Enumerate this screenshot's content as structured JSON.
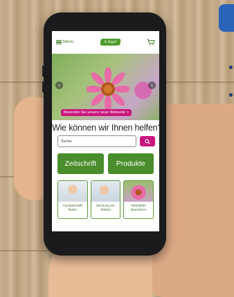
{
  "header": {
    "menu_label": "Menu",
    "logo_text": "A.Vogel",
    "cart_icon": "cart-icon"
  },
  "hero": {
    "review_button": "Bewerten Sie unsere neue Webseite >"
  },
  "heading": "Wie können wir Ihnen helfen?",
  "search": {
    "placeholder": "Suche"
  },
  "buttons": {
    "zeitschrift": "Zeitschrift",
    "produkte": "Produkte"
  },
  "tiles": [
    {
      "line1": "Fachgeschäft",
      "line2": "finden"
    },
    {
      "line1": "Beratung am",
      "line2": "Telefon"
    },
    {
      "line1": "Newsletter",
      "line2": "abonnieren"
    }
  ],
  "colors": {
    "brand_green": "#4a8d2c",
    "accent_magenta": "#c8167c"
  }
}
